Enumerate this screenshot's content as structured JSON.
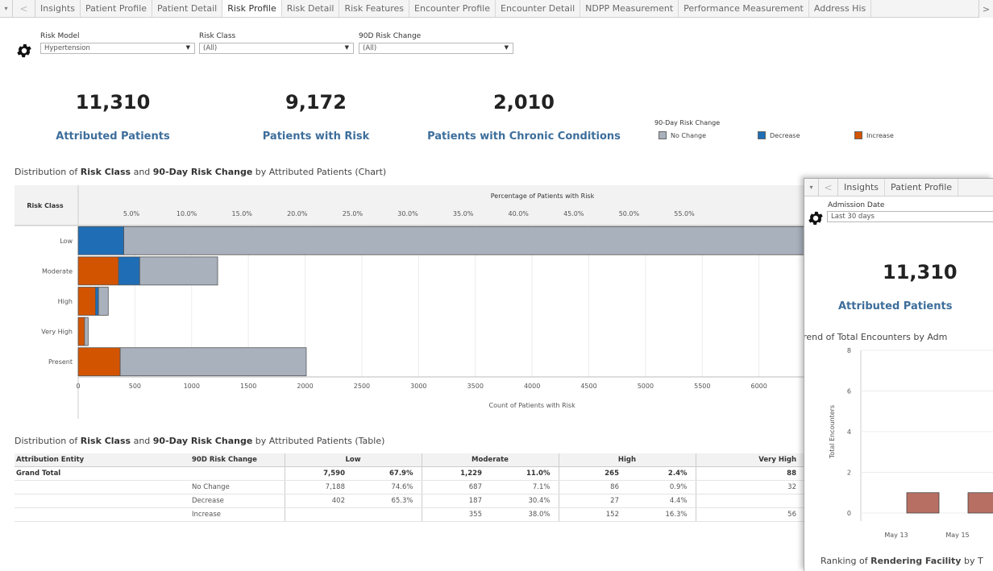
{
  "tabs": {
    "items": [
      "Insights",
      "Patient Profile",
      "Patient Detail",
      "Risk Profile",
      "Risk Detail",
      "Risk Features",
      "Encounter Profile",
      "Encounter Detail",
      "NDPP Measurement",
      "Performance Measurement",
      "Address His"
    ],
    "active": "Risk Profile",
    "nav_prev": "<",
    "nav_next": ">",
    "menu": "▾"
  },
  "filters": {
    "risk_model": {
      "label": "Risk Model",
      "value": "Hypertension"
    },
    "risk_class": {
      "label": "Risk Class",
      "value": "(All)"
    },
    "risk_change": {
      "label": "90D Risk Change",
      "value": "(All)"
    }
  },
  "kpis": [
    {
      "value": "11,310",
      "label": "Attributed Patients"
    },
    {
      "value": "9,172",
      "label": "Patients with Risk"
    },
    {
      "value": "2,010",
      "label": "Patients with Chronic Conditions"
    }
  ],
  "legend": {
    "title": "90-Day Risk Change",
    "items": [
      {
        "label": "No Change",
        "color": "#a9b1bd"
      },
      {
        "label": "Decrease",
        "color": "#1f6eb5"
      },
      {
        "label": "Increase",
        "color": "#d35400"
      }
    ]
  },
  "chart_section": {
    "prefix": "Distribution of ",
    "b1": "Risk Class",
    "mid": " and ",
    "b2": "90-Day Risk Change",
    "suffix": " by Attributed Patients (Chart)"
  },
  "chart_data": {
    "type": "bar",
    "orientation": "horizontal",
    "stacked": true,
    "row_header": "Risk Class",
    "top_axis_title": "Percentage of Patients with Risk",
    "top_ticks": [
      "5.0%",
      "10.0%",
      "15.0%",
      "20.0%",
      "25.0%",
      "30.0%",
      "35.0%",
      "40.0%",
      "45.0%",
      "50.0%",
      "55.0%"
    ],
    "xlabel": "Count of Patients with Risk",
    "xticks": [
      0,
      500,
      1000,
      1500,
      2000,
      2500,
      3000,
      3500,
      4000,
      4500,
      5000,
      5500,
      6000
    ],
    "categories": [
      "Low",
      "Moderate",
      "High",
      "Very High",
      "Present"
    ],
    "series": [
      {
        "name": "Increase",
        "color": "#d35400",
        "values": [
          0,
          355,
          152,
          56,
          370
        ]
      },
      {
        "name": "Decrease",
        "color": "#1f6eb5",
        "values": [
          402,
          187,
          27,
          0,
          0
        ]
      },
      {
        "name": "No Change",
        "color": "#a9b1bd",
        "values": [
          7188,
          687,
          86,
          32,
          1640
        ]
      }
    ],
    "xlim": [
      0,
      6400
    ]
  },
  "table_section": {
    "prefix": "Distribution of ",
    "b1": "Risk Class",
    "mid": " and ",
    "b2": "90-Day Risk Change",
    "suffix": " by Attributed Patients (Table)"
  },
  "table": {
    "headers": [
      "Attribution Entity",
      "90D Risk Change",
      "Low",
      "Moderate",
      "High",
      "Very High"
    ],
    "rows": [
      {
        "entity": "Grand Total",
        "change": "",
        "low_n": "7,590",
        "low_p": "67.9%",
        "mod_n": "1,229",
        "mod_p": "11.0%",
        "high_n": "265",
        "high_p": "2.4%",
        "vh_n": "88"
      },
      {
        "entity": "",
        "change": "No Change",
        "low_n": "7,188",
        "low_p": "74.6%",
        "mod_n": "687",
        "mod_p": "7.1%",
        "high_n": "86",
        "high_p": "0.9%",
        "vh_n": "32"
      },
      {
        "entity": "",
        "change": "Decrease",
        "low_n": "402",
        "low_p": "65.3%",
        "mod_n": "187",
        "mod_p": "30.4%",
        "high_n": "27",
        "high_p": "4.4%",
        "vh_n": ""
      },
      {
        "entity": "",
        "change": "Increase",
        "low_n": "",
        "low_p": "",
        "mod_n": "355",
        "mod_p": "38.0%",
        "high_n": "152",
        "high_p": "16.3%",
        "vh_n": "56"
      }
    ]
  },
  "popup": {
    "tabs": [
      "Insights",
      "Patient Profile"
    ],
    "filter_label": "Admission Date",
    "filter_value": "Last 30 days",
    "kpi_value": "11,310",
    "kpi_label": "Attributed Patients",
    "trend_title": "Trend of Total Encounters by Adm",
    "ylabel": "Total Encounters",
    "yticks": [
      "8",
      "6",
      "4",
      "2",
      "0"
    ],
    "xticks": [
      "May 13",
      "May 15"
    ],
    "bar_values": [
      1,
      1
    ],
    "bar_color": "#b86f63",
    "ranking_prefix": "Ranking of ",
    "ranking_bold": "Rendering Facility",
    "ranking_suffix": " by T"
  }
}
